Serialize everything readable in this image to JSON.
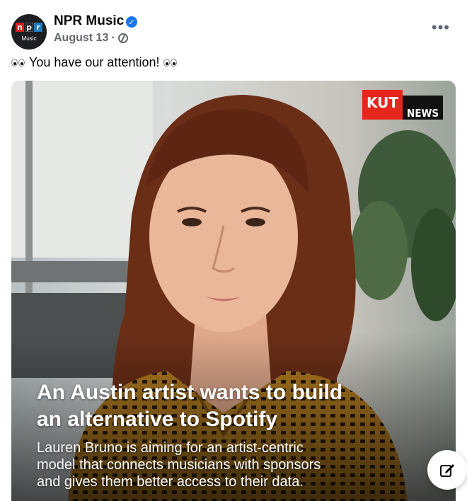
{
  "post": {
    "page_name": "NPR Music",
    "avatar_sub": "Music",
    "verified_icon": "verified-badge-icon",
    "date": "August 13",
    "separator": "·",
    "audience_icon": "globe-icon",
    "more_icon": "more-options-icon",
    "more_label": "•••",
    "caption": "You have our attention!"
  },
  "media": {
    "brand_red": "KUT",
    "brand_black": "NEWS",
    "headline_line1": "An Austin artist wants to build",
    "headline_line2": "an alternative to Spotify",
    "subline_line1": "Lauren Bruno is aiming for an artist-centric",
    "subline_line2": "model that connects musicians with sponsors",
    "subline_line3": "and gives them better access to their data."
  },
  "colors": {
    "accent": "#1877f2",
    "npr_red": "#d62021",
    "npr_blue": "#237bbd",
    "kut_red": "#e5261d",
    "muted_text": "#65676b"
  },
  "fab": {
    "icon": "compose-icon"
  }
}
